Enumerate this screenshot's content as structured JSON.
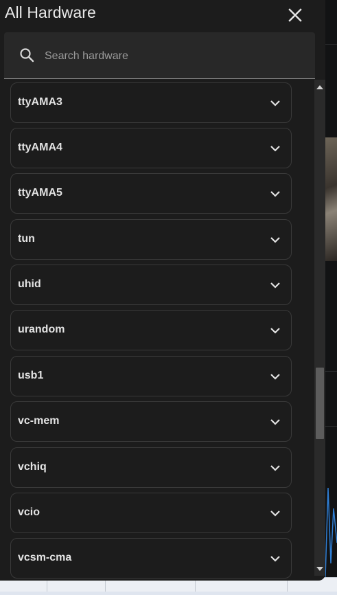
{
  "dialog": {
    "title": "All Hardware",
    "close_icon": "close-icon"
  },
  "search": {
    "placeholder": "Search hardware",
    "value": "",
    "icon": "search-icon"
  },
  "hardware_items": [
    {
      "label": "ttyAMA3"
    },
    {
      "label": "ttyAMA4"
    },
    {
      "label": "ttyAMA5"
    },
    {
      "label": "tun"
    },
    {
      "label": "uhid"
    },
    {
      "label": "urandom"
    },
    {
      "label": "usb1"
    },
    {
      "label": "vc-mem"
    },
    {
      "label": "vchiq"
    },
    {
      "label": "vcio"
    },
    {
      "label": "vcsm-cma"
    }
  ],
  "icons": {
    "expand": "chevron-down-icon",
    "scroll_up": "triangle-up-icon",
    "scroll_down": "triangle-down-icon"
  },
  "colors": {
    "dialog_bg": "#1c1c1c",
    "item_border": "#3a3a3a",
    "text": "#e3e3e3",
    "placeholder": "#9a9a9a",
    "scroll_thumb": "#5c5c5c"
  }
}
